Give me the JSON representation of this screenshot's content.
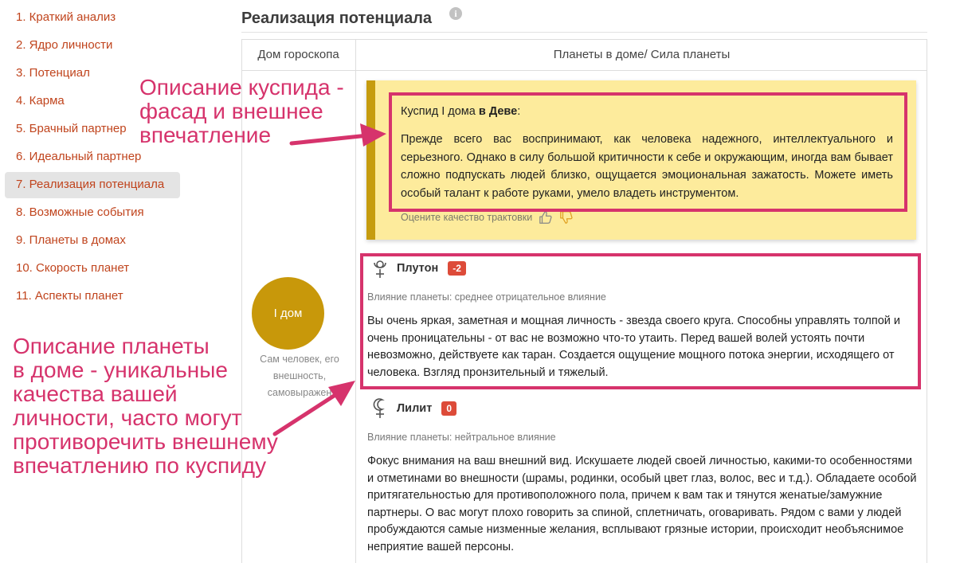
{
  "sidebar": {
    "items": [
      {
        "label": "1. Краткий анализ"
      },
      {
        "label": "2. Ядро личности"
      },
      {
        "label": "3. Потенциал"
      },
      {
        "label": "4. Карма"
      },
      {
        "label": "5. Брачный партнер"
      },
      {
        "label": "6. Идеальный партнер"
      },
      {
        "label": "7. Реализация потенциала",
        "active": true
      },
      {
        "label": "8. Возможные события"
      },
      {
        "label": "9. Планеты в домах"
      },
      {
        "label": "10. Скорость планет"
      },
      {
        "label": "11. Аспекты планет"
      }
    ]
  },
  "page": {
    "title": "Реализация потенциала",
    "info_icon": "i"
  },
  "table": {
    "col_house": "Дом гороскопа",
    "col_planets": "Планеты в доме/ Сила планеты"
  },
  "house": {
    "label": "I дом",
    "description": "Сам человек, его\nвнешность,\nсамовыражен"
  },
  "cusp": {
    "heading_prefix": "Куспид I дома ",
    "heading_sign": "в Деве",
    "heading_suffix": ":",
    "text": "Прежде всего вас воспринимают, как человека надежного, интеллектуального и серьезного. Однако в силу большой критичности к себе и окружающим, иногда вам бывает сложно подпускать людей близко, ощущается эмоциональная зажатость. Можете иметь особый талант к работе руками, умело владеть инструментом.",
    "rate_label": "Оцените качество трактовки"
  },
  "planets": [
    {
      "name": "Плутон",
      "strength": "-2",
      "influence": "Влияние планеты: среднее отрицательное влияние",
      "text": "Вы очень яркая, заметная и мощная личность - звезда своего круга. Способны управлять толпой и очень проницательны - от вас не возможно что-то утаить. Перед вашей волей устоять почти невозможно, действуете как таран. Создается ощущение мощного потока энергии, исходящего от человека. Взгляд пронзительный и тяжелый."
    },
    {
      "name": "Лилит",
      "strength": "0",
      "influence": "Влияние планеты: нейтральное влияние",
      "text": "Фокус внимания на ваш внешний вид. Искушаете людей своей личностью, какими-то особенностями и отметинами во внешности (шрамы, родинки, особый цвет глаз, волос, вес и т.д.). Обладаете особой притягательностью для противоположного пола, причем к вам так и тянутся женатые/замужние партнеры. О вас могут плохо говорить за спиной, сплетничать, оговаривать. Рядом с вами у людей пробуждаются самые низменные желания, всплывают грязные истории, происходит необъяснимое неприятие вашей персоны."
    }
  ],
  "annotations": {
    "cusp": "Описание куспида -\nфасад и внешнее\nвпечатление",
    "planet": "Описание планеты\nв доме - уникальные\nкачества вашей\nличности, часто могут\nпротиворечить внешнему\nвпечатлению по куспиду"
  },
  "colors": {
    "accent_link": "#c0441d",
    "house_gold": "#c8980a",
    "highlight_magenta": "#d6336c",
    "card_yellow": "#fdeb9c",
    "badge_red": "#dd4b39"
  },
  "icons": {
    "pluto": "pluto-symbol-icon",
    "lilith": "lilith-symbol-icon",
    "like": "thumbs-up-icon",
    "dislike": "thumbs-down-icon",
    "info": "info-icon"
  }
}
